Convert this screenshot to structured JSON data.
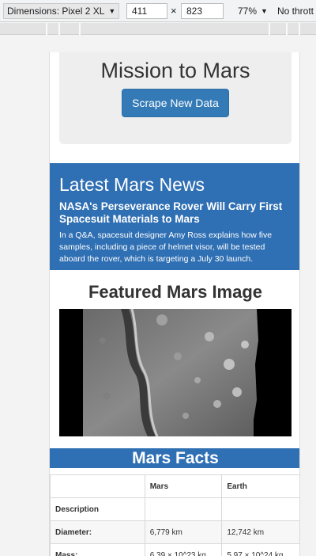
{
  "devtools": {
    "device_label": "Dimensions: Pixel 2 XL",
    "width": "411",
    "times": "×",
    "height": "823",
    "zoom": "77%",
    "throttle": "No thrott"
  },
  "page": {
    "jumbotron": {
      "title": "Mission to Mars",
      "button_label": "Scrape New Data"
    },
    "news": {
      "heading": "Latest Mars News",
      "title": "NASA's Perseverance Rover Will Carry First Spacesuit Materials to Mars",
      "paragraph": "In a Q&A, spacesuit designer Amy Ross explains how five samples, including a piece of helmet visor, will be tested aboard the rover, which is targeting a July 30 launch."
    },
    "featured": {
      "heading": "Featured Mars Image"
    },
    "facts": {
      "heading": "Mars Facts",
      "columns": [
        "",
        "Mars",
        "Earth"
      ],
      "rows": [
        [
          "Description",
          "",
          ""
        ],
        [
          "Diameter:",
          "6,779 km",
          "12,742 km"
        ],
        [
          "Mass:",
          "6.39 × 10^23 kg",
          "5.97 × 10^24 kg"
        ]
      ]
    }
  },
  "colors": {
    "primary_button": "#337ab7",
    "news_background": "#2f6fb3",
    "jumbotron_background": "#eeeeee"
  }
}
